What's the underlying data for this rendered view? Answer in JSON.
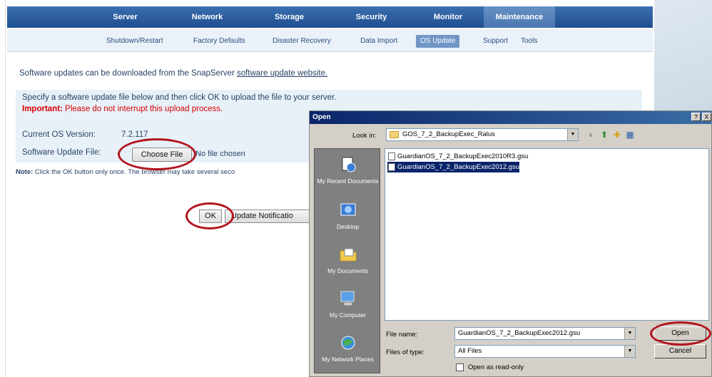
{
  "nav": {
    "tabs": [
      "Server",
      "Network",
      "Storage",
      "Security",
      "Monitor",
      "Maintenance"
    ],
    "active": "Maintenance"
  },
  "subnav": {
    "tabs": [
      "Shutdown/Restart",
      "Factory Defaults",
      "Disaster Recovery",
      "Data Import",
      "OS Update",
      "Support",
      "Tools"
    ],
    "active": "OS Update"
  },
  "page": {
    "intro_text": "Software updates can be downloaded from the SnapServer ",
    "intro_link": "software update website.",
    "instruction": "Specify a software update file below and then click OK to upload the file to your server.",
    "important_label": "Important:",
    "important_text": " Please do not interrupt this upload process.",
    "current_os_label": "Current OS Version:",
    "current_os_value": "7.2.117",
    "update_file_label": "Software Update File:",
    "choose_file_label": "Choose File",
    "no_file_text": "No file chosen",
    "note_label": "Note:",
    "note_text": " Click the OK button only once. The browser may take several seco",
    "ok_label": "OK",
    "update_notification_label": "Update Notificatio"
  },
  "dialog": {
    "title": "Open",
    "title_buttons": [
      "?",
      "X"
    ],
    "look_in_label": "Look in:",
    "look_in_value": "GOS_7_2_BackupExec_Ralus",
    "places": [
      {
        "label": "My Recent Documents",
        "icon": "recent-documents-icon"
      },
      {
        "label": "Desktop",
        "icon": "desktop-icon"
      },
      {
        "label": "My Documents",
        "icon": "my-documents-icon"
      },
      {
        "label": "My Computer",
        "icon": "my-computer-icon"
      },
      {
        "label": "My Network Places",
        "icon": "network-places-icon"
      }
    ],
    "files": [
      {
        "name": "GuardianOS_7_2_BackupExec2010R3.gsu",
        "selected": false
      },
      {
        "name": "GuardianOS_7_2_BackupExec2012.gsu",
        "selected": true
      }
    ],
    "file_name_label": "File name:",
    "file_name_value": "GuardianOS_7_2_BackupExec2012.gsu",
    "file_type_label": "Files of type:",
    "file_type_value": "All Files",
    "read_only_label": "Open as read-only",
    "open_label": "Open",
    "cancel_label": "Cancel"
  },
  "colors": {
    "highlight_circle": "#b3141c",
    "nav_blue": "#1f4e8f",
    "important_red": "#d40000"
  }
}
